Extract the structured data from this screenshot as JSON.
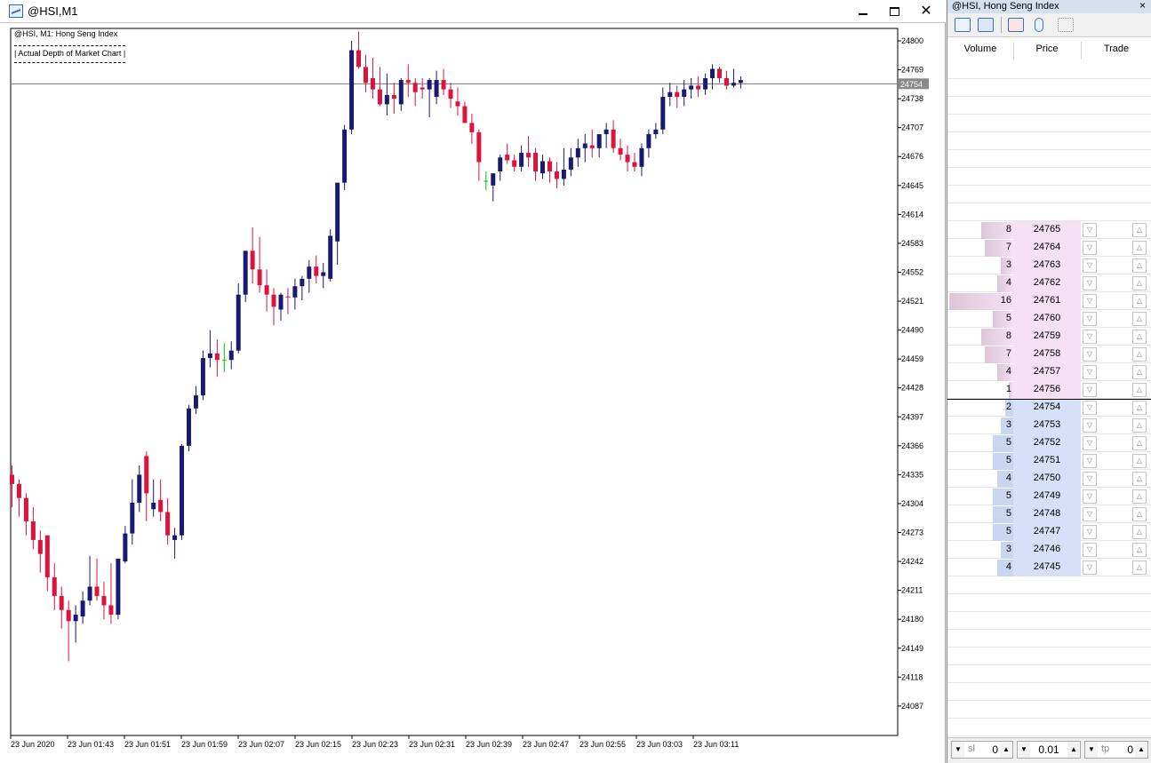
{
  "window": {
    "title": "@HSI,M1"
  },
  "chart": {
    "legend_line1": "@HSI, M1:  Hong Seng Index",
    "legend_line2": "| Actual Depth of Market Chart |",
    "current_price_label": "24754"
  },
  "chart_data": {
    "type": "candlestick",
    "symbol": "@HSI",
    "timeframe": "M1",
    "ylim": [
      24065,
      24806
    ],
    "y_ticks": [
      24800,
      24769,
      24738,
      24707,
      24676,
      24645,
      24614,
      24583,
      24552,
      24521,
      24490,
      24459,
      24428,
      24397,
      24366,
      24335,
      24304,
      24273,
      24242,
      24211,
      24180,
      24149,
      24118,
      24087
    ],
    "x_ticks": [
      "23 Jun 2020",
      "23 Jun 01:43",
      "23 Jun 01:51",
      "23 Jun 01:59",
      "23 Jun 02:07",
      "23 Jun 02:15",
      "23 Jun 02:23",
      "23 Jun 02:31",
      "23 Jun 02:39",
      "23 Jun 02:47",
      "23 Jun 02:55",
      "23 Jun 03:03",
      "23 Jun 03:11"
    ],
    "current_price": 24754,
    "colors": {
      "bull": "#191970",
      "bear": "#dc143c",
      "doji": "#00c000",
      "grid": "#000000"
    },
    "candles": [
      [
        24335,
        24345,
        24300,
        24325
      ],
      [
        24325,
        24330,
        24290,
        24310
      ],
      [
        24310,
        24315,
        24270,
        24285
      ],
      [
        24285,
        24300,
        24255,
        24265
      ],
      [
        24265,
        24275,
        24230,
        24250
      ],
      [
        24270,
        24270,
        24210,
        24225
      ],
      [
        24225,
        24240,
        24190,
        24205
      ],
      [
        24205,
        24215,
        24170,
        24190
      ],
      [
        24190,
        24200,
        24135,
        24178
      ],
      [
        24178,
        24195,
        24155,
        24185
      ],
      [
        24183,
        24210,
        24175,
        24200
      ],
      [
        24200,
        24248,
        24195,
        24215
      ],
      [
        24215,
        24245,
        24200,
        24205
      ],
      [
        24205,
        24220,
        24180,
        24195
      ],
      [
        24195,
        24240,
        24175,
        24185
      ],
      [
        24185,
        24245,
        24180,
        24245
      ],
      [
        24242,
        24280,
        24240,
        24272
      ],
      [
        24272,
        24330,
        24260,
        24305
      ],
      [
        24305,
        24345,
        24295,
        24335
      ],
      [
        24355,
        24360,
        24285,
        24315
      ],
      [
        24298,
        24330,
        24290,
        24305
      ],
      [
        24308,
        24330,
        24285,
        24295
      ],
      [
        24295,
        24310,
        24260,
        24270
      ],
      [
        24265,
        24278,
        24245,
        24270
      ],
      [
        24270,
        24368,
        24265,
        24366
      ],
      [
        24366,
        24410,
        24360,
        24406
      ],
      [
        24406,
        24430,
        24400,
        24420
      ],
      [
        24420,
        24468,
        24415,
        24460
      ],
      [
        24460,
        24490,
        24450,
        24465
      ],
      [
        24465,
        24480,
        24440,
        24458
      ],
      [
        24458,
        24476,
        24445,
        24458
      ],
      [
        24458,
        24478,
        24448,
        24468
      ],
      [
        24468,
        24540,
        24465,
        24528
      ],
      [
        24528,
        24570,
        24520,
        24575
      ],
      [
        24575,
        24600,
        24540,
        24555
      ],
      [
        24555,
        24590,
        24530,
        24538
      ],
      [
        24538,
        24555,
        24510,
        24528
      ],
      [
        24528,
        24535,
        24495,
        24515
      ],
      [
        24512,
        24530,
        24500,
        24528
      ],
      [
        24526,
        24535,
        24507,
        24525
      ],
      [
        24525,
        24545,
        24512,
        24537
      ],
      [
        24537,
        24548,
        24522,
        24545
      ],
      [
        24545,
        24565,
        24530,
        24558
      ],
      [
        24558,
        24570,
        24540,
        24548
      ],
      [
        24548,
        24562,
        24535,
        24552
      ],
      [
        24545,
        24598,
        24542,
        24591
      ],
      [
        24585,
        24632,
        24560,
        24648
      ],
      [
        24648,
        24710,
        24640,
        24705
      ],
      [
        24705,
        24800,
        24700,
        24790
      ],
      [
        24790,
        24810,
        24770,
        24772
      ],
      [
        24772,
        24785,
        24745,
        24755
      ],
      [
        24760,
        24782,
        24738,
        24748
      ],
      [
        24748,
        24772,
        24730,
        24732
      ],
      [
        24732,
        24765,
        24720,
        24742
      ],
      [
        24742,
        24755,
        24722,
        24738
      ],
      [
        24732,
        24760,
        24725,
        24758
      ],
      [
        24758,
        24775,
        24740,
        24755
      ],
      [
        24755,
        24760,
        24730,
        24745
      ],
      [
        24750,
        24760,
        24738,
        24748
      ],
      [
        24748,
        24760,
        24718,
        24758
      ],
      [
        24740,
        24768,
        24732,
        24758
      ],
      [
        24758,
        24770,
        24742,
        24748
      ],
      [
        24748,
        24755,
        24728,
        24738
      ],
      [
        24735,
        24750,
        24720,
        24730
      ],
      [
        24730,
        24735,
        24715,
        24712
      ],
      [
        24712,
        24722,
        24690,
        24702
      ],
      [
        24702,
        24705,
        24650,
        24670
      ],
      [
        24650,
        24660,
        24640,
        24650
      ],
      [
        24645,
        24655,
        24628,
        24658
      ],
      [
        24660,
        24678,
        24650,
        24675
      ],
      [
        24678,
        24690,
        24668,
        24672
      ],
      [
        24672,
        24678,
        24660,
        24665
      ],
      [
        24665,
        24688,
        24660,
        24680
      ],
      [
        24680,
        24698,
        24665,
        24675
      ],
      [
        24680,
        24685,
        24650,
        24660
      ],
      [
        24658,
        24678,
        24652,
        24671
      ],
      [
        24671,
        24675,
        24648,
        24660
      ],
      [
        24660,
        24670,
        24642,
        24652
      ],
      [
        24652,
        24685,
        24645,
        24662
      ],
      [
        24662,
        24685,
        24655,
        24675
      ],
      [
        24675,
        24695,
        24665,
        24685
      ],
      [
        24685,
        24700,
        24670,
        24690
      ],
      [
        24688,
        24705,
        24675,
        24685
      ],
      [
        24685,
        24698,
        24675,
        24700
      ],
      [
        24700,
        24712,
        24685,
        24705
      ],
      [
        24705,
        24715,
        24680,
        24685
      ],
      [
        24685,
        24695,
        24672,
        24678
      ],
      [
        24678,
        24688,
        24660,
        24670
      ],
      [
        24670,
        24680,
        24660,
        24665
      ],
      [
        24665,
        24690,
        24655,
        24685
      ],
      [
        24685,
        24705,
        24675,
        24700
      ],
      [
        24700,
        24712,
        24695,
        24705
      ],
      [
        24705,
        24750,
        24700,
        24740
      ],
      [
        24740,
        24755,
        24730,
        24745
      ],
      [
        24745,
        24752,
        24728,
        24740
      ],
      [
        24740,
        24758,
        24730,
        24748
      ],
      [
        24748,
        24760,
        24738,
        24752
      ],
      [
        24752,
        24762,
        24740,
        24748
      ],
      [
        24748,
        24765,
        24742,
        24760
      ],
      [
        24760,
        24775,
        24748,
        24770
      ],
      [
        24770,
        24772,
        24755,
        24760
      ],
      [
        24760,
        24768,
        24748,
        24752
      ],
      [
        24752,
        24770,
        24750,
        24755
      ],
      [
        24755,
        24762,
        24749,
        24758
      ]
    ]
  },
  "dom": {
    "title": "@HSI, Hong Seng Index",
    "close_glyph": "×",
    "headers": {
      "volume": "Volume",
      "price": "Price",
      "trade": "Trade"
    },
    "asks": [
      {
        "volume": "8",
        "price": "24765",
        "depth": 8
      },
      {
        "volume": "7",
        "price": "24764",
        "depth": 7
      },
      {
        "volume": "3",
        "price": "24763",
        "depth": 3
      },
      {
        "volume": "4",
        "price": "24762",
        "depth": 4
      },
      {
        "volume": "16",
        "price": "24761",
        "depth": 16
      },
      {
        "volume": "5",
        "price": "24760",
        "depth": 5
      },
      {
        "volume": "8",
        "price": "24759",
        "depth": 8
      },
      {
        "volume": "7",
        "price": "24758",
        "depth": 7
      },
      {
        "volume": "4",
        "price": "24757",
        "depth": 4
      },
      {
        "volume": "1",
        "price": "24756",
        "depth": 1
      }
    ],
    "bids": [
      {
        "volume": "2",
        "price": "24754",
        "depth": 2
      },
      {
        "volume": "3",
        "price": "24753",
        "depth": 3
      },
      {
        "volume": "5",
        "price": "24752",
        "depth": 5
      },
      {
        "volume": "5",
        "price": "24751",
        "depth": 5
      },
      {
        "volume": "4",
        "price": "24750",
        "depth": 4
      },
      {
        "volume": "5",
        "price": "24749",
        "depth": 5
      },
      {
        "volume": "5",
        "price": "24748",
        "depth": 5
      },
      {
        "volume": "5",
        "price": "24747",
        "depth": 5
      },
      {
        "volume": "3",
        "price": "24746",
        "depth": 3
      },
      {
        "volume": "4",
        "price": "24745",
        "depth": 4
      }
    ],
    "ask_color": "#f7e0f3",
    "bid_color": "#d6e1f8",
    "ask_bar_color": "#dcc6d8",
    "bid_bar_color": "#c8d6f0",
    "bottom": {
      "sl_label": "sl",
      "sl_value": "0",
      "lot_value": "0.01",
      "tp_label": "tp",
      "tp_value": "0"
    }
  }
}
